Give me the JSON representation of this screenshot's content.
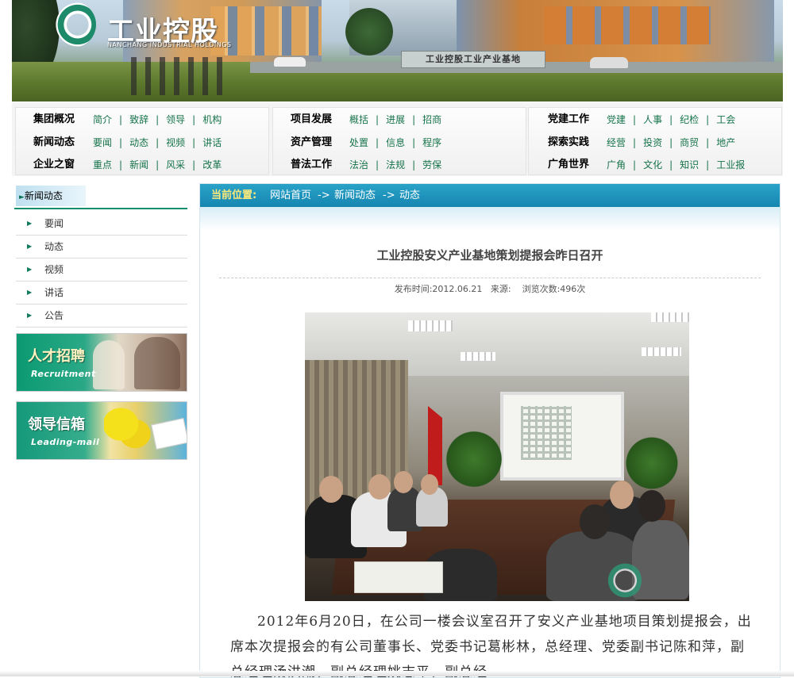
{
  "banner": {
    "logo_text": "工业控股",
    "logo_sub": "NANCHANG INDUSTRIAL HOLDINGS",
    "sign_text": "工业控股工业产业基地"
  },
  "nav": {
    "groups": [
      {
        "rows": [
          {
            "title": "集团概况",
            "links": [
              "简介",
              "致辞",
              "领导",
              "机构"
            ]
          },
          {
            "title": "新闻动态",
            "links": [
              "要闻",
              "动态",
              "视频",
              "讲话"
            ]
          },
          {
            "title": "企业之窗",
            "links": [
              "重点",
              "新闻",
              "风采",
              "改革"
            ]
          }
        ]
      },
      {
        "rows": [
          {
            "title": "项目发展",
            "links": [
              "概括",
              "进展",
              "招商"
            ]
          },
          {
            "title": "资产管理",
            "links": [
              "处置",
              "信息",
              "程序"
            ]
          },
          {
            "title": "普法工作",
            "links": [
              "法治",
              "法规",
              "劳保"
            ]
          }
        ]
      },
      {
        "rows": [
          {
            "title": "党建工作",
            "links": [
              "党建",
              "人事",
              "纪检",
              "工会"
            ]
          },
          {
            "title": "探索实践",
            "links": [
              "经营",
              "投资",
              "商贸",
              "地产"
            ]
          },
          {
            "title": "广角世界",
            "links": [
              "广角",
              "文化",
              "知识",
              "工业报"
            ]
          }
        ]
      }
    ]
  },
  "sidebar": {
    "title": "新闻动态",
    "items": [
      "要闻",
      "动态",
      "视频",
      "讲话",
      "公告"
    ],
    "promo1": {
      "title": "人才招聘",
      "sub": "Recruitment"
    },
    "promo2": {
      "title": "领导信箱",
      "sub": "Leading-mail"
    }
  },
  "breadcrumb": {
    "label": "当前位置:",
    "items": [
      "网站首页",
      "->",
      "新闻动态",
      "->",
      "动态"
    ]
  },
  "article": {
    "title": "工业控股安义产业基地策划提报会昨日召开",
    "meta": "发布时间:2012.06.21   来源:    浏览次数:496次",
    "body": "2012年6月20日，在公司一楼会议室召开了安义产业基地项目策划提报会，出席本次提报会的有公司董事长、党委书记葛彬林，总经理、党委副书记陈和萍，副总经理汤洪潮，副总经理姚志平，副总经"
  },
  "colors": {
    "accent_green": "#16734b",
    "crumb_blue": "#1a93bd",
    "crumb_label": "#ffe97a"
  }
}
